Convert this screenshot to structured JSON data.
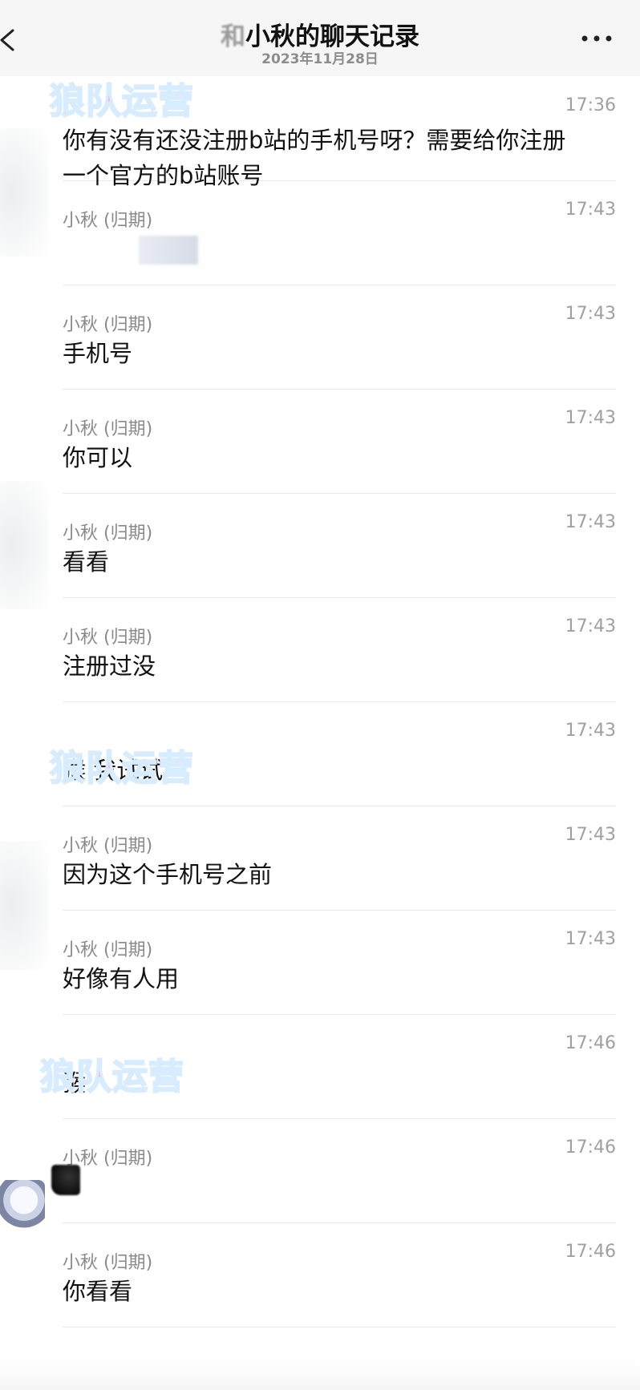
{
  "header": {
    "title_obscured": "和",
    "title": "小秋的聊天记录",
    "subtitle": "2023年11月28日",
    "back_icon": "back-icon",
    "more_icon": "more-icon"
  },
  "watermark": "狼队运营",
  "messages": [
    {
      "sender": "",
      "time": "17:36",
      "text": "你有没有还没注册b站的手机号呀？需要给你注册一个官方的b站账号"
    },
    {
      "sender": "小秋 (归期)",
      "time": "17:43",
      "text": ""
    },
    {
      "sender": "小秋 (归期)",
      "time": "17:43",
      "text": "手机号"
    },
    {
      "sender": "小秋 (归期)",
      "time": "17:43",
      "text": "你可以"
    },
    {
      "sender": "小秋 (归期)",
      "time": "17:43",
      "text": "看看"
    },
    {
      "sender": "小秋 (归期)",
      "time": "17:43",
      "text": "注册过没"
    },
    {
      "sender": "",
      "time": "17:43",
      "text": "猴 我试试"
    },
    {
      "sender": "小秋 (归期)",
      "time": "17:43",
      "text": "因为这个手机号之前"
    },
    {
      "sender": "小秋 (归期)",
      "time": "17:43",
      "text": "好像有人用"
    },
    {
      "sender": "",
      "time": "17:46",
      "text": "猴"
    },
    {
      "sender": "小秋 (归期)",
      "time": "17:46",
      "text": ""
    },
    {
      "sender": "小秋 (归期)",
      "time": "17:46",
      "text": "你看看"
    }
  ]
}
